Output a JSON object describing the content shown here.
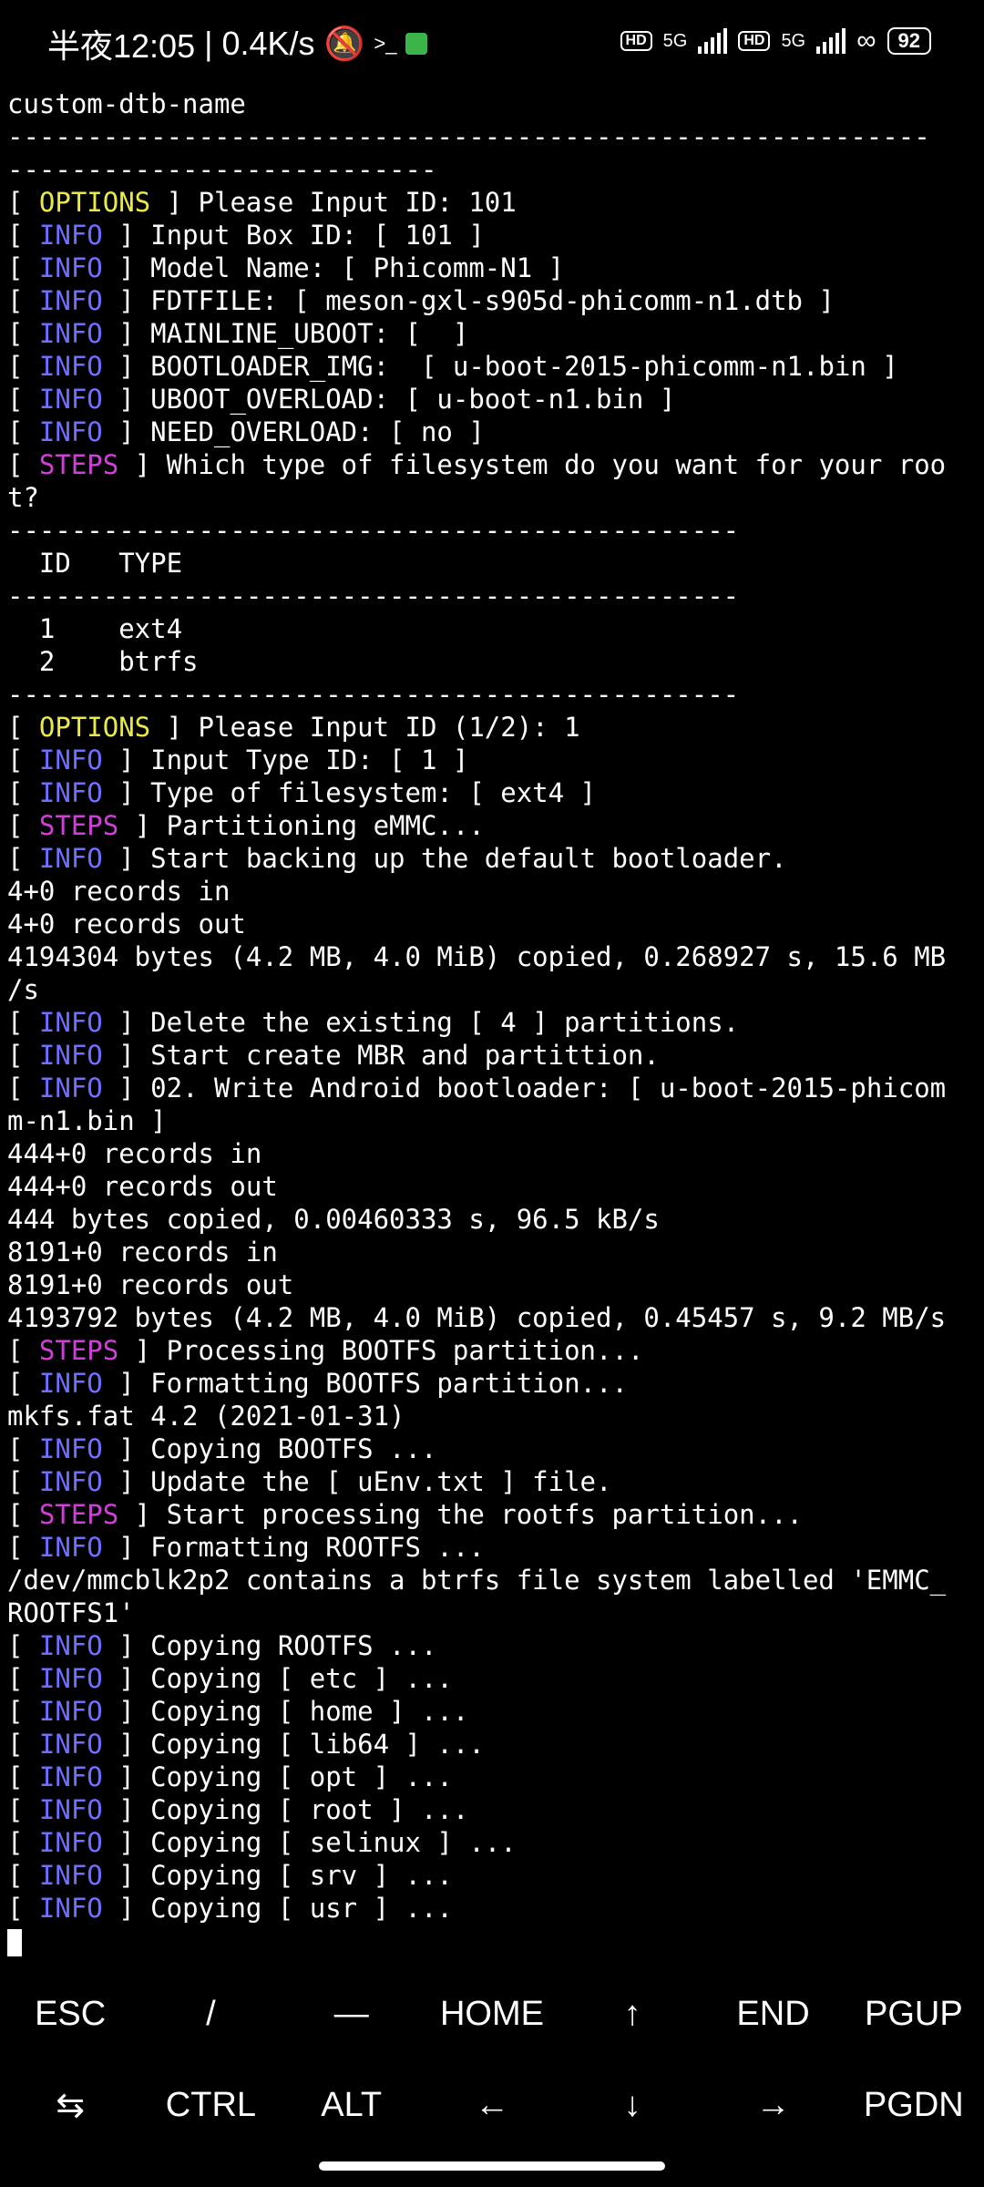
{
  "status_bar": {
    "time": "半夜12:05",
    "speed": "0.4K/s",
    "net1": "5G",
    "net2": "5G",
    "hd1": "HD",
    "hd2": "HD",
    "battery": "92"
  },
  "terminal": {
    "lines": [
      {
        "text": "custom-dtb-name"
      },
      {
        "text": "----------------------------------------------------------"
      },
      {
        "text": "---------------------------"
      },
      {
        "tag": "OPTIONS",
        "cls": "opt",
        "text": " Please Input ID: 101"
      },
      {
        "tag": "INFO",
        "cls": "info",
        "text": " Input Box ID: [ 101 ]"
      },
      {
        "tag": "INFO",
        "cls": "info",
        "text": " Model Name: [ Phicomm-N1 ]"
      },
      {
        "tag": "INFO",
        "cls": "info",
        "text": " FDTFILE: [ meson-gxl-s905d-phicomm-n1.dtb ]"
      },
      {
        "tag": "INFO",
        "cls": "info",
        "text": " MAINLINE_UBOOT: [  ]"
      },
      {
        "tag": "INFO",
        "cls": "info",
        "text": " BOOTLOADER_IMG:  [ u-boot-2015-phicomm-n1.bin ]"
      },
      {
        "tag": "INFO",
        "cls": "info",
        "text": " UBOOT_OVERLOAD: [ u-boot-n1.bin ]"
      },
      {
        "tag": "INFO",
        "cls": "info",
        "text": " NEED_OVERLOAD: [ no ]"
      },
      {
        "tag": "STEPS",
        "cls": "steps",
        "text": " Which type of filesystem do you want for your roo"
      },
      {
        "text": "t?"
      },
      {
        "text": "----------------------------------------------"
      },
      {
        "text": "  ID   TYPE"
      },
      {
        "text": "----------------------------------------------"
      },
      {
        "text": "  1    ext4"
      },
      {
        "text": "  2    btrfs"
      },
      {
        "text": "----------------------------------------------"
      },
      {
        "tag": "OPTIONS",
        "cls": "opt",
        "text": " Please Input ID (1/2): 1"
      },
      {
        "tag": "INFO",
        "cls": "info",
        "text": " Input Type ID: [ 1 ]"
      },
      {
        "tag": "INFO",
        "cls": "info",
        "text": " Type of filesystem: [ ext4 ]"
      },
      {
        "tag": "STEPS",
        "cls": "steps",
        "text": " Partitioning eMMC..."
      },
      {
        "tag": "INFO",
        "cls": "info",
        "text": " Start backing up the default bootloader."
      },
      {
        "text": "4+0 records in"
      },
      {
        "text": "4+0 records out"
      },
      {
        "text": "4194304 bytes (4.2 MB, 4.0 MiB) copied, 0.268927 s, 15.6 MB"
      },
      {
        "text": "/s"
      },
      {
        "tag": "INFO",
        "cls": "info",
        "text": " Delete the existing [ 4 ] partitions."
      },
      {
        "tag": "INFO",
        "cls": "info",
        "text": " Start create MBR and partittion."
      },
      {
        "tag": "INFO",
        "cls": "info",
        "text": " 02. Write Android bootloader: [ u-boot-2015-phicom"
      },
      {
        "text": "m-n1.bin ]"
      },
      {
        "text": "444+0 records in"
      },
      {
        "text": "444+0 records out"
      },
      {
        "text": "444 bytes copied, 0.00460333 s, 96.5 kB/s"
      },
      {
        "text": "8191+0 records in"
      },
      {
        "text": "8191+0 records out"
      },
      {
        "text": "4193792 bytes (4.2 MB, 4.0 MiB) copied, 0.45457 s, 9.2 MB/s"
      },
      {
        "tag": "STEPS",
        "cls": "steps",
        "text": " Processing BOOTFS partition..."
      },
      {
        "tag": "INFO",
        "cls": "info",
        "text": " Formatting BOOTFS partition..."
      },
      {
        "text": "mkfs.fat 4.2 (2021-01-31)"
      },
      {
        "tag": "INFO",
        "cls": "info",
        "text": " Copying BOOTFS ..."
      },
      {
        "tag": "INFO",
        "cls": "info",
        "text": " Update the [ uEnv.txt ] file."
      },
      {
        "tag": "STEPS",
        "cls": "steps",
        "text": " Start processing the rootfs partition..."
      },
      {
        "tag": "INFO",
        "cls": "info",
        "text": " Formatting ROOTFS ..."
      },
      {
        "text": "/dev/mmcblk2p2 contains a btrfs file system labelled 'EMMC_"
      },
      {
        "text": "ROOTFS1'"
      },
      {
        "tag": "INFO",
        "cls": "info",
        "text": " Copying ROOTFS ..."
      },
      {
        "tag": "INFO",
        "cls": "info",
        "text": " Copying [ etc ] ..."
      },
      {
        "tag": "INFO",
        "cls": "info",
        "text": " Copying [ home ] ..."
      },
      {
        "tag": "INFO",
        "cls": "info",
        "text": " Copying [ lib64 ] ..."
      },
      {
        "tag": "INFO",
        "cls": "info",
        "text": " Copying [ opt ] ..."
      },
      {
        "tag": "INFO",
        "cls": "info",
        "text": " Copying [ root ] ..."
      },
      {
        "tag": "INFO",
        "cls": "info",
        "text": " Copying [ selinux ] ..."
      },
      {
        "tag": "INFO",
        "cls": "info",
        "text": " Copying [ srv ] ..."
      },
      {
        "tag": "INFO",
        "cls": "info",
        "text": " Copying [ usr ] ..."
      }
    ]
  },
  "extra_keys": {
    "row1": [
      "ESC",
      "/",
      "—",
      "HOME",
      "↑",
      "END",
      "PGUP"
    ],
    "row2": [
      "⇆",
      "CTRL",
      "ALT",
      "←",
      "↓",
      "→",
      "PGDN"
    ]
  }
}
